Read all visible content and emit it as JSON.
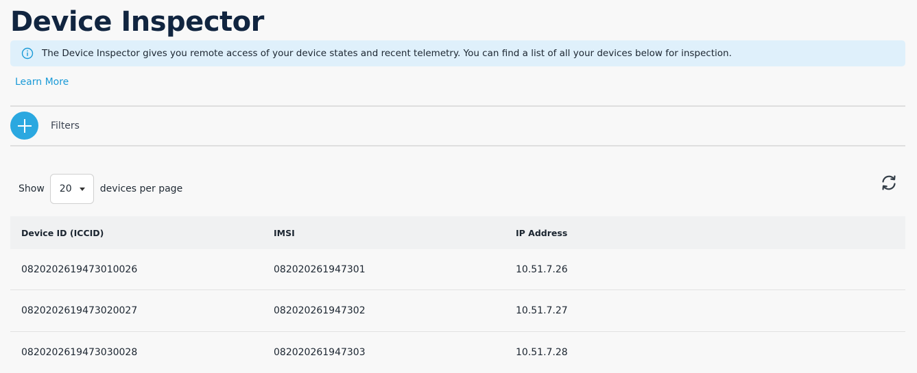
{
  "page": {
    "title": "Device Inspector"
  },
  "info_banner": {
    "icon": "info-icon",
    "text": "The Device Inspector gives you remote access of your device states and recent telemetry. You can find a list of all your devices below for inspection."
  },
  "learn_more": {
    "label": "Learn More"
  },
  "filters": {
    "icon": "plus-icon",
    "label": "Filters"
  },
  "pager": {
    "show_label": "Show",
    "page_size": "20",
    "suffix_label": "devices per page",
    "refresh_icon": "refresh-icon"
  },
  "table": {
    "columns": [
      "Device ID (ICCID)",
      "IMSI",
      "IP Address"
    ],
    "rows": [
      [
        "0820202619473010026",
        "082020261947301",
        "10.51.7.26"
      ],
      [
        "0820202619473020027",
        "082020261947302",
        "10.51.7.27"
      ],
      [
        "0820202619473030028",
        "082020261947303",
        "10.51.7.28"
      ]
    ]
  },
  "colors": {
    "accent": "#2ba8e0",
    "link": "#1a9ad7",
    "banner_bg": "#dff0fb",
    "title": "#112540"
  }
}
